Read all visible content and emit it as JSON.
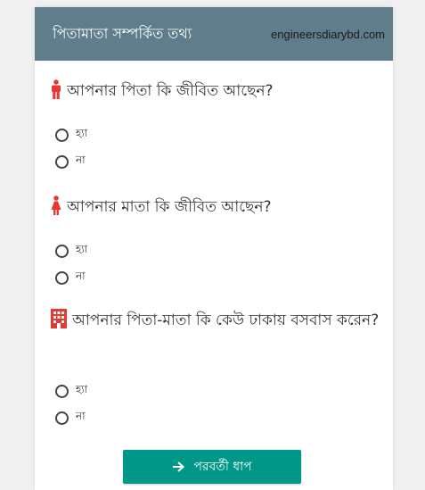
{
  "header": {
    "title": "পিতামাতা সম্পর্কিত তথ্য",
    "site": "engineersdiarybd.com"
  },
  "questions": [
    {
      "icon": "male-icon",
      "text": "আপনার পিতা কি জীবিত আছেন?",
      "options": [
        "হ্যা",
        "না"
      ]
    },
    {
      "icon": "female-icon",
      "text": "আপনার মাতা কি জীবিত আছেন?",
      "options": [
        "হ্যা",
        "না"
      ]
    },
    {
      "icon": "building-icon",
      "text": "আপনার পিতা-মাতা কি কেউ ঢাকায় বসবাস করেন?",
      "options": [
        "হ্যা",
        "না"
      ]
    }
  ],
  "next_button": {
    "label": "পরবর্তী ধাপ",
    "icon": "arrow-right-icon"
  },
  "colors": {
    "header_bg": "#607d8b",
    "accent": "#009688",
    "icon_red": "#e53935"
  }
}
